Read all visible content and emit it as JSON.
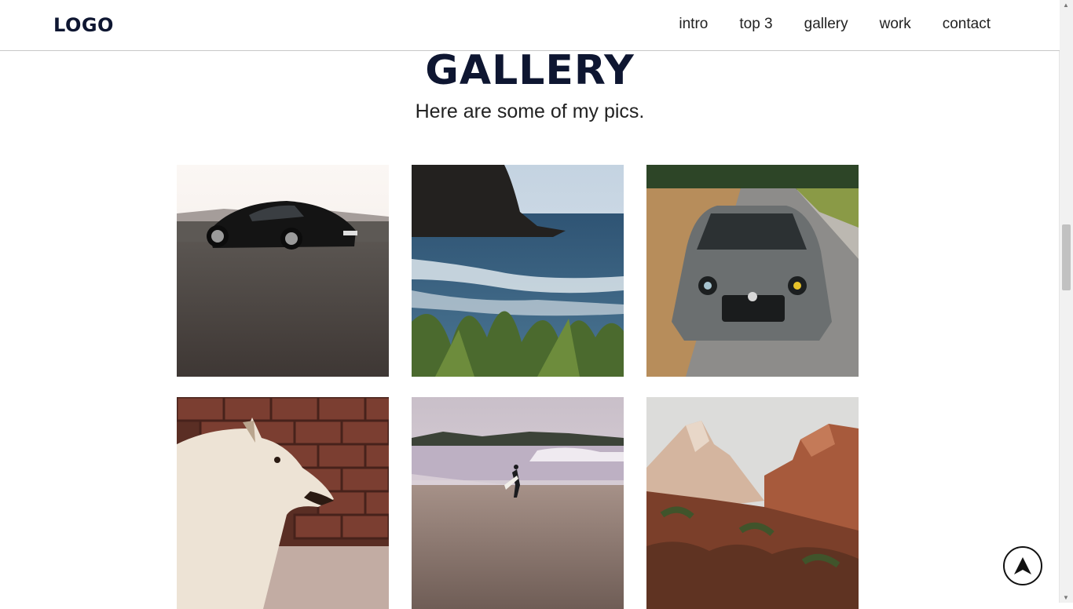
{
  "header": {
    "logo": "LOGO",
    "nav": [
      {
        "label": "intro"
      },
      {
        "label": "top 3"
      },
      {
        "label": "gallery"
      },
      {
        "label": "work"
      },
      {
        "label": "contact"
      }
    ]
  },
  "gallery": {
    "title": "GALLERY",
    "subtitle": "Here are some of my pics.",
    "photos": [
      {
        "subject": "black sports car parked by the sea"
      },
      {
        "subject": "coastal cliff and ocean waves behind grass"
      },
      {
        "subject": "grey hatchback car front view on road"
      },
      {
        "subject": "white dog against brick wall"
      },
      {
        "subject": "surfer walking on beach"
      },
      {
        "subject": "red rock canyon cliffs"
      }
    ]
  },
  "scroll_to_top": {
    "icon": "arrow-up-icon"
  },
  "colors": {
    "brand": "#0e1631",
    "text": "#222222"
  }
}
